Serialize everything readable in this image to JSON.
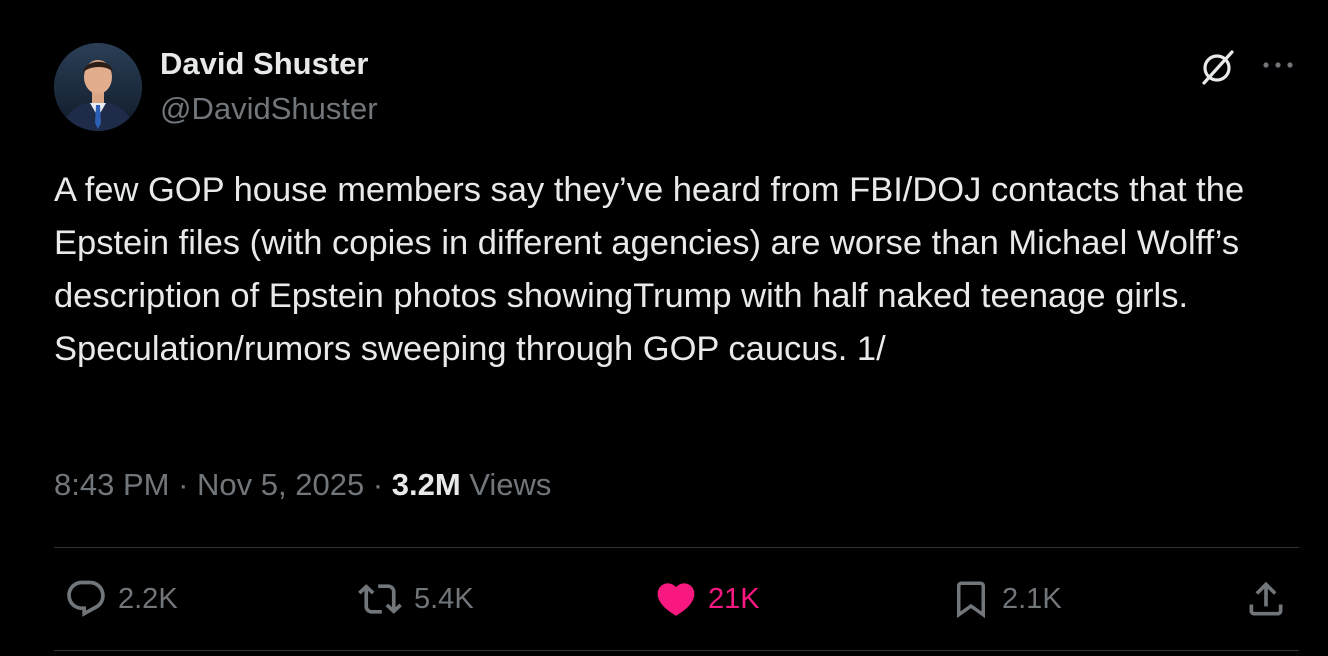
{
  "author": {
    "name": "David Shuster",
    "handle": "@DavidShuster"
  },
  "tweet": {
    "text": "A few GOP house members say they’ve heard from FBI/DOJ contacts that the Epstein files (with copies in different agencies) are worse than Michael Wolff’s description of Epstein photos showingTrump with half naked teenage girls. Speculation/rumors sweeping through GOP caucus. 1/",
    "time": "8:43 PM",
    "separator": " · ",
    "date": "Nov 5, 2025",
    "views_count": "3.2M",
    "views_label": "Views"
  },
  "actions": {
    "replies": "2.2K",
    "reposts": "5.4K",
    "likes": "21K",
    "bookmarks": "2.1K"
  },
  "icons": {
    "top_right": [
      "grok-icon",
      "more-icon"
    ],
    "actions": [
      "reply-icon",
      "repost-icon",
      "like-icon",
      "bookmark-icon",
      "share-icon"
    ]
  },
  "colors": {
    "background": "#000000",
    "text_primary": "#e7e9ea",
    "text_secondary": "#71767b",
    "like_active": "#f91880",
    "divider": "#2f3336"
  }
}
